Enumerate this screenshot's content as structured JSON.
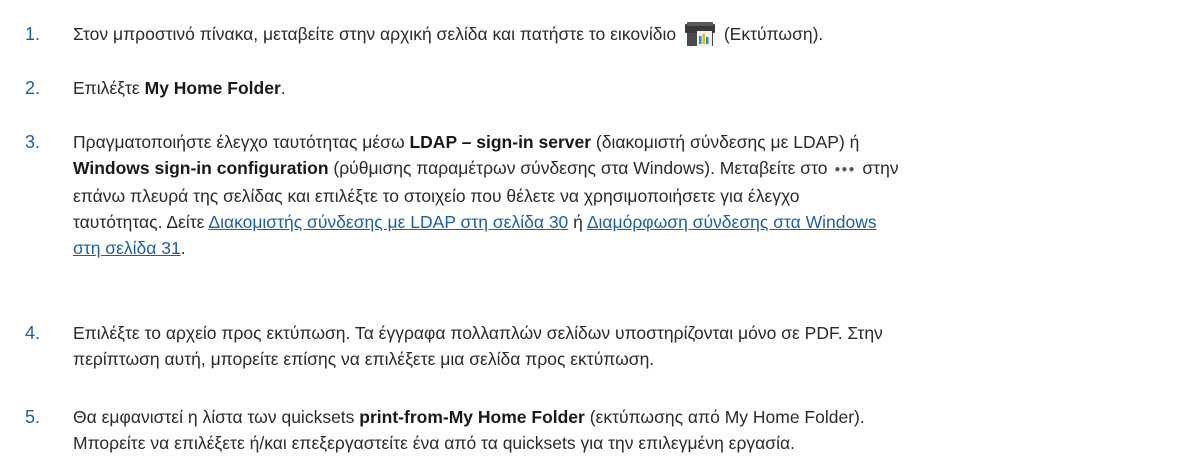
{
  "steps": [
    {
      "number": "1.",
      "before_icon": "Στον μπροστινό πίνακα, μεταβείτε στην αρχική σελίδα και πατήστε το εικονίδιο",
      "icon": "printer-icon",
      "after_icon": "(Εκτύπωση)."
    },
    {
      "number": "2.",
      "prefix": "Επιλέξτε",
      "bold": "My Home Folder",
      "suffix": "."
    },
    {
      "number": "3.",
      "line1_a": "Πραγματοποιήστε έλεγχο ταυτότητας μέσω",
      "line1_bold": "LDAP – sign-in server",
      "line1_b": "(διακομιστή σύνδεσης με LDAP) ή",
      "line2_bold": "Windows sign-in configuration",
      "line2_a": "(ρύθμισης παραμέτρων σύνδεσης στα Windows). Μεταβείτε στο",
      "dots_icon": "more-dots-icon",
      "line2_b": "στην",
      "line3": "επάνω πλευρά της σελίδας και επιλέξτε το στοιχείο που θέλετε να χρησιμοποιήσετε για έλεγχο",
      "line4_a": "ταυτότητας. Δείτε",
      "link1": "Διακομιστής σύνδεσης με LDAP στη σελίδα 30",
      "line4_b": "ή",
      "link2_part1": "Διαμόρφωση σύνδεσης στα Windows",
      "link2_part2": "στη σελίδα 31",
      "line5_end": "."
    },
    {
      "number": "4.",
      "line1": "Επιλέξτε το αρχείο προς εκτύπωση. Τα έγγραφα πολλαπλών σελίδων υποστηρίζονται μόνο σε PDF. Στην",
      "line2": "περίπτωση αυτή, μπορείτε επίσης να επιλέξετε μια σελίδα προς εκτύπωση."
    },
    {
      "number": "5.",
      "line1_a": "Θα εμφανιστεί η λίστα των quicksets",
      "line1_bold": "print-from-My Home Folder",
      "line1_b": "(εκτύπωσης από My Home Folder).",
      "line2": "Μπορείτε να επιλέξετε ή/και επεξεργαστείτε ένα από τα quicksets για την επιλεγμένη εργασία."
    }
  ]
}
